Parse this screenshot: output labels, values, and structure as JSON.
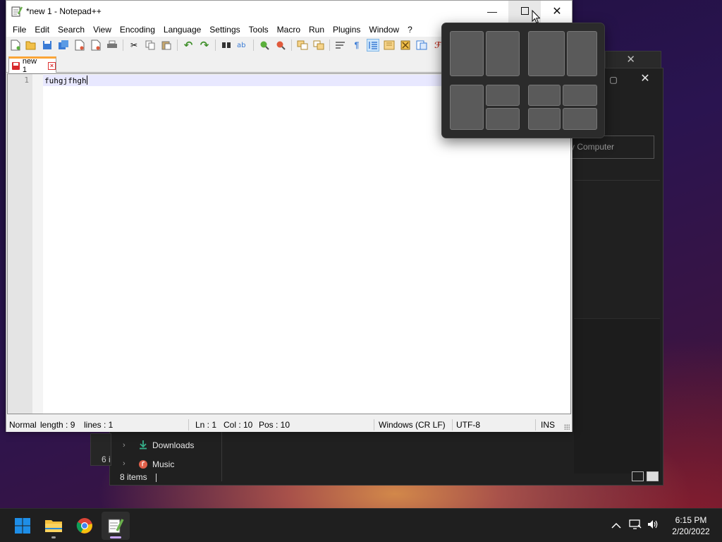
{
  "notepad": {
    "title": "*new 1 - Notepad++",
    "menus": [
      "File",
      "Edit",
      "Search",
      "View",
      "Encoding",
      "Language",
      "Settings",
      "Tools",
      "Macro",
      "Run",
      "Plugins",
      "Window",
      "?"
    ],
    "tab_label": "new 1",
    "line_number": "1",
    "content": "fuhgjfhgh",
    "status": {
      "mode": "Normal",
      "length": "length : 9",
      "lines": "lines : 1",
      "ln": "Ln : 1",
      "col": "Col : 10",
      "pos": "Pos : 10",
      "eol": "Windows (CR LF)",
      "encoding": "UTF-8",
      "insert": "INS"
    }
  },
  "explorer": {
    "search_placeholder": "y Computer",
    "nav_items": [
      {
        "label": "Downloads",
        "icon": "download-icon"
      },
      {
        "label": "Music",
        "icon": "music-icon"
      }
    ],
    "status_text": "8 items",
    "partial_status": "6 i"
  },
  "snap_layouts": {
    "layouts": [
      "two-columns-equal",
      "two-columns-wide-left",
      "main-left-two-stacked-right",
      "four-quadrants"
    ]
  },
  "taskbar": {
    "apps": [
      "windows-start-icon",
      "file-explorer-icon",
      "chrome-icon",
      "notepad-plus-plus-icon"
    ],
    "time": "6:15 PM",
    "date": "2/20/2022"
  },
  "colors": {
    "tab_accent": "#fba537",
    "current_line": "#e8e8ff",
    "taskbar_bg": "#1f1f1f",
    "snap_bg": "#2b2b2b",
    "windows_blue": "#0a7fd8"
  }
}
